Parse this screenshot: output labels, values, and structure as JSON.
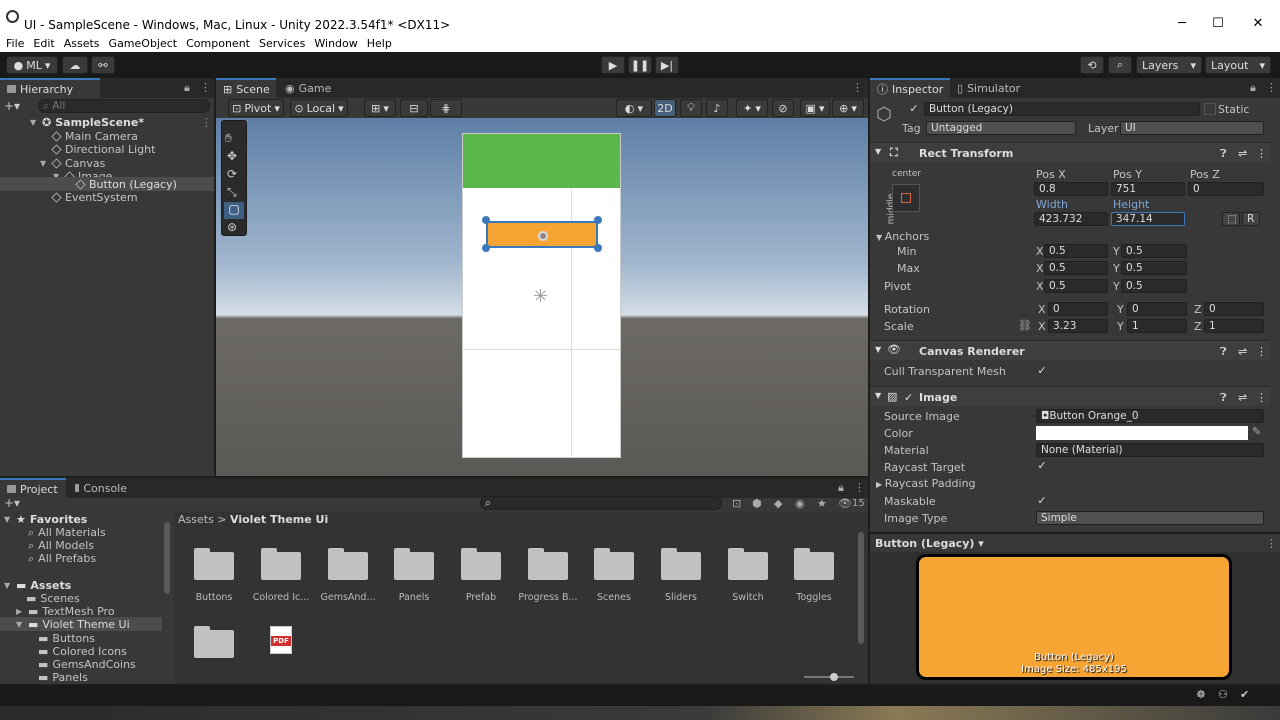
{
  "window": {
    "title": "UI - SampleScene - Windows, Mac, Linux - Unity 2022.3.54f1* <DX11>",
    "minimize": "─",
    "maximize": "☐",
    "close": "✕"
  },
  "menu": [
    "File",
    "Edit",
    "Assets",
    "GameObject",
    "Component",
    "Services",
    "Window",
    "Help"
  ],
  "toolbar": {
    "account": "ML",
    "layers": "Layers",
    "layout": "Layout"
  },
  "hierarchy": {
    "tab": "Hierarchy",
    "search_placeholder": "All",
    "items": [
      {
        "label": "SampleScene*",
        "depth": 0
      },
      {
        "label": "Main Camera",
        "depth": 1
      },
      {
        "label": "Directional Light",
        "depth": 1
      },
      {
        "label": "Canvas",
        "depth": 1
      },
      {
        "label": "Image",
        "depth": 2
      },
      {
        "label": "Button (Legacy)",
        "depth": 3
      },
      {
        "label": "EventSystem",
        "depth": 1
      }
    ]
  },
  "scene": {
    "tabs": [
      "Scene",
      "Game"
    ],
    "pivot": "Pivot",
    "local": "Local",
    "mode2d": "2D"
  },
  "inspector": {
    "tabs": [
      "Inspector",
      "Simulator"
    ],
    "object_name": "Button (Legacy)",
    "static": "Static",
    "tag_label": "Tag",
    "tag": "Untagged",
    "layer_label": "Layer",
    "layer": "UI",
    "rect": {
      "title": "Rect Transform",
      "anchor_h": "center",
      "anchor_v": "middle",
      "posx_label": "Pos X",
      "posy_label": "Pos Y",
      "posz_label": "Pos Z",
      "posx": "0.8",
      "posy": "751",
      "posz": "0",
      "width_label": "Width",
      "height_label": "Height",
      "width": "423.732",
      "height": "347.14",
      "anchors": "Anchors",
      "min": "Min",
      "max": "Max",
      "pivot": "Pivot",
      "min_x": "0.5",
      "min_y": "0.5",
      "max_x": "0.5",
      "max_y": "0.5",
      "pivot_x": "0.5",
      "pivot_y": "0.5",
      "rotation": "Rotation",
      "scale": "Scale",
      "rot_x": "0",
      "rot_y": "0",
      "rot_z": "0",
      "scale_x": "3.23",
      "scale_y": "1",
      "scale_z": "1",
      "x": "X",
      "y": "Y",
      "z": "Z",
      "r": "R"
    },
    "canvas_renderer": {
      "title": "Canvas Renderer",
      "cull": "Cull Transparent Mesh"
    },
    "image": {
      "title": "Image",
      "source_image_label": "Source Image",
      "source_image": "Button Orange_0",
      "color_label": "Color",
      "material_label": "Material",
      "material": "None (Material)",
      "raycast_target": "Raycast Target",
      "raycast_padding": "Raycast Padding",
      "maskable": "Maskable",
      "image_type_label": "Image Type",
      "image_type": "Simple"
    },
    "preview": {
      "title": "Button (Legacy)",
      "caption1": "Button (Legacy)",
      "caption2": "Image Size: 485x195"
    }
  },
  "project": {
    "tabs": [
      "Project",
      "Console"
    ],
    "search_count": "15",
    "favorites": {
      "title": "Favorites",
      "items": [
        "All Materials",
        "All Models",
        "All Prefabs"
      ]
    },
    "assets": {
      "title": "Assets",
      "items": [
        "Scenes",
        "TextMesh Pro",
        "Violet Theme Ui"
      ],
      "sub": [
        "Buttons",
        "Colored Icons",
        "GemsAndCoins",
        "Panels"
      ]
    },
    "breadcrumb": [
      "Assets",
      "Violet Theme Ui"
    ],
    "folders": [
      "Buttons",
      "Colored Ic...",
      "GemsAnd...",
      "Panels",
      "Prefab",
      "Progress B...",
      "Scenes",
      "Sliders",
      "Switch",
      "Toggles"
    ],
    "pdf": "PDF"
  },
  "colors": {
    "accent": "#3a79bb",
    "orange": "#f6a434",
    "green": "#5ab94a",
    "selection": "#2c5d87"
  }
}
